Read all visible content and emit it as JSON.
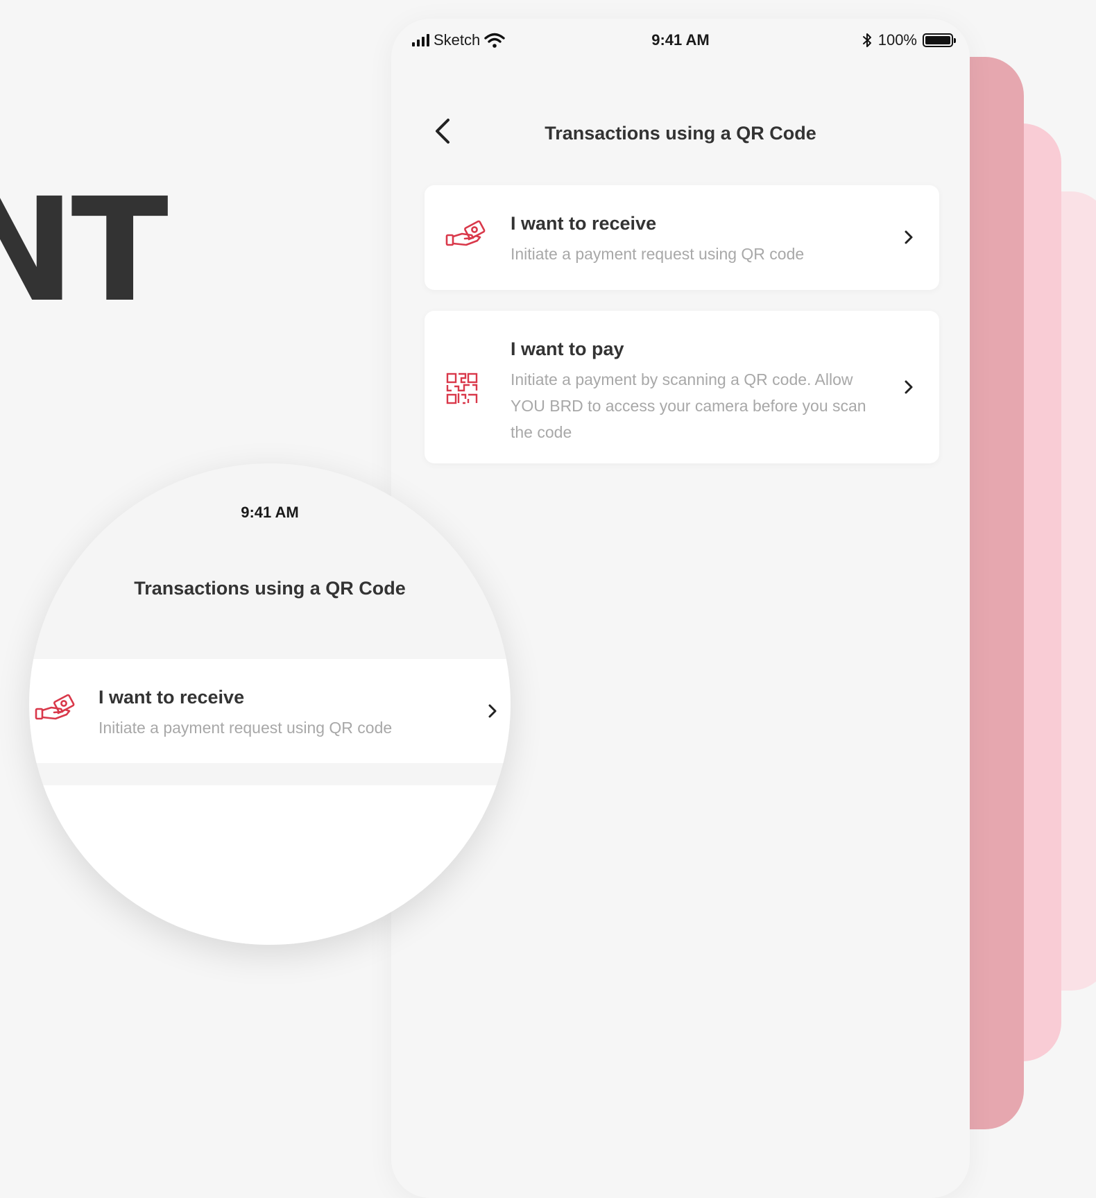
{
  "headline": "NT",
  "status_bar": {
    "carrier": "Sketch",
    "time": "9:41 AM",
    "battery": "100%"
  },
  "header": {
    "title": "Transactions using a QR Code"
  },
  "options": [
    {
      "title": "I want to receive",
      "description": "Initiate a payment request using QR code"
    },
    {
      "title": "I want to pay",
      "description": "Initiate a payment by scanning a QR code. Allow YOU BRD to access your camera before you scan the code"
    }
  ],
  "magnifier": {
    "time": "9:41 AM",
    "title": "Transactions using a QR Code",
    "option": {
      "title": "I want to receive",
      "description": "Initiate a payment request using QR code"
    }
  },
  "colors": {
    "accent": "#d9384a",
    "background": "#f6f6f6",
    "stack_dark": "#e6a7af",
    "stack_mid": "#f9ccd5",
    "stack_light": "#fae1e6"
  }
}
